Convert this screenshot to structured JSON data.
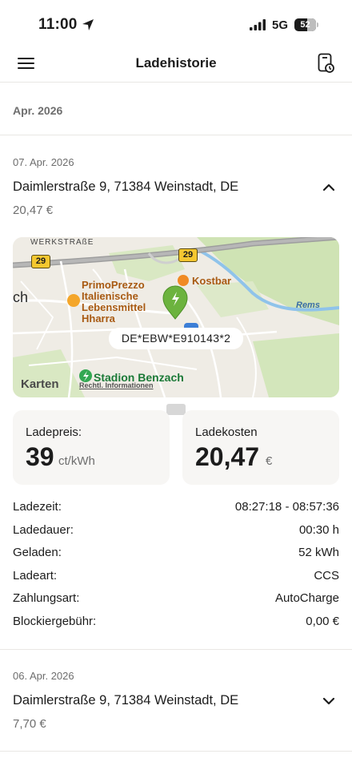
{
  "status_bar": {
    "time": "11:00",
    "network": "5G",
    "battery": "52"
  },
  "header": {
    "title": "Ladehistorie"
  },
  "month_header": "Apr. 2026",
  "entries": [
    {
      "date": "07. Apr. 2026",
      "address": "Daimlerstraße 9, 71384 Weinstadt, DE",
      "price": "20,47 €",
      "expanded": true,
      "map": {
        "street_label": "WERKSTRAßE",
        "road_numbers": [
          "29",
          "29"
        ],
        "poi_1": [
          "PrimoPrezzo",
          "Italienische",
          "Lebensmittel",
          "Hharra"
        ],
        "poi_2": "Kostbar",
        "river": "Rems",
        "place_fragment": "ch",
        "station_id": "DE*EBW*E910143*2",
        "station_name": "Stadion Benzach",
        "attribution": "Karten",
        "legal": "Rechtl. Informationen"
      },
      "cards": {
        "price": {
          "label": "Ladepreis:",
          "value": "39",
          "unit": "ct/kWh"
        },
        "cost": {
          "label": "Ladekosten",
          "value": "20,47",
          "unit": "€"
        }
      },
      "details": [
        {
          "label": "Ladezeit:",
          "value": "08:27:18 - 08:57:36"
        },
        {
          "label": "Ladedauer:",
          "value": "00:30 h"
        },
        {
          "label": "Geladen:",
          "value": "52 kWh"
        },
        {
          "label": "Ladeart:",
          "value": "CCS"
        },
        {
          "label": "Zahlungsart:",
          "value": "AutoCharge"
        },
        {
          "label": "Blockiergebühr:",
          "value": "0,00 €"
        }
      ]
    },
    {
      "date": "06. Apr. 2026",
      "address": "Daimlerstraße 9, 71384 Weinstadt, DE",
      "price": "7,70 €",
      "expanded": false
    }
  ],
  "icons": {
    "menu": "hamburger-menu-icon",
    "document": "phone-document-icon",
    "location": "location-arrow-icon",
    "collapse": "chevron-up-icon",
    "expand": "chevron-down-icon",
    "charger_pin": "charging-pin-icon"
  },
  "colors": {
    "accent_green": "#6cb33e",
    "card_bg": "#f7f6f4",
    "muted_text": "#6e6e6e"
  }
}
